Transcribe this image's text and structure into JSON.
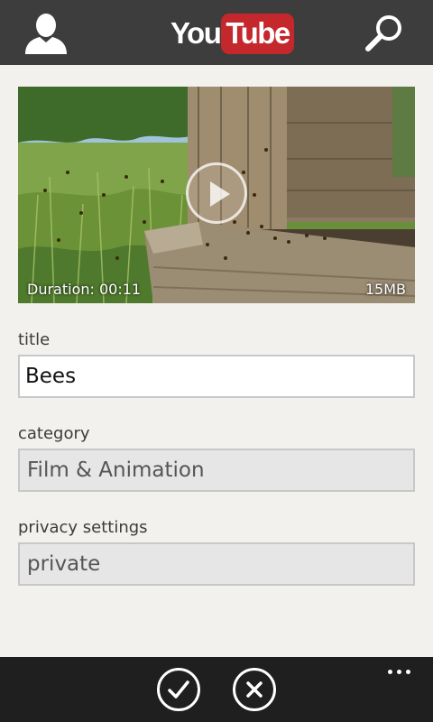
{
  "app": {
    "logo_you": "You",
    "logo_tube": "Tube",
    "brand_red": "#c4272c",
    "top_bar_color": "#3d3d3d",
    "bottom_bar_color": "#1f1f1f"
  },
  "header": {
    "left_icon": "account-icon",
    "right_icon": "search-icon"
  },
  "video": {
    "duration_text": "Duration: 00:11",
    "size_text": "15MB",
    "overlay_icon": "play-icon"
  },
  "form": {
    "title_label": "title",
    "title_value": "Bees",
    "category_label": "category",
    "category_value": "Film & Animation",
    "privacy_label": "privacy settings",
    "privacy_value": "private"
  },
  "appbar": {
    "confirm_icon": "checkmark-icon",
    "cancel_icon": "close-icon",
    "more_icon": "more-icon"
  }
}
